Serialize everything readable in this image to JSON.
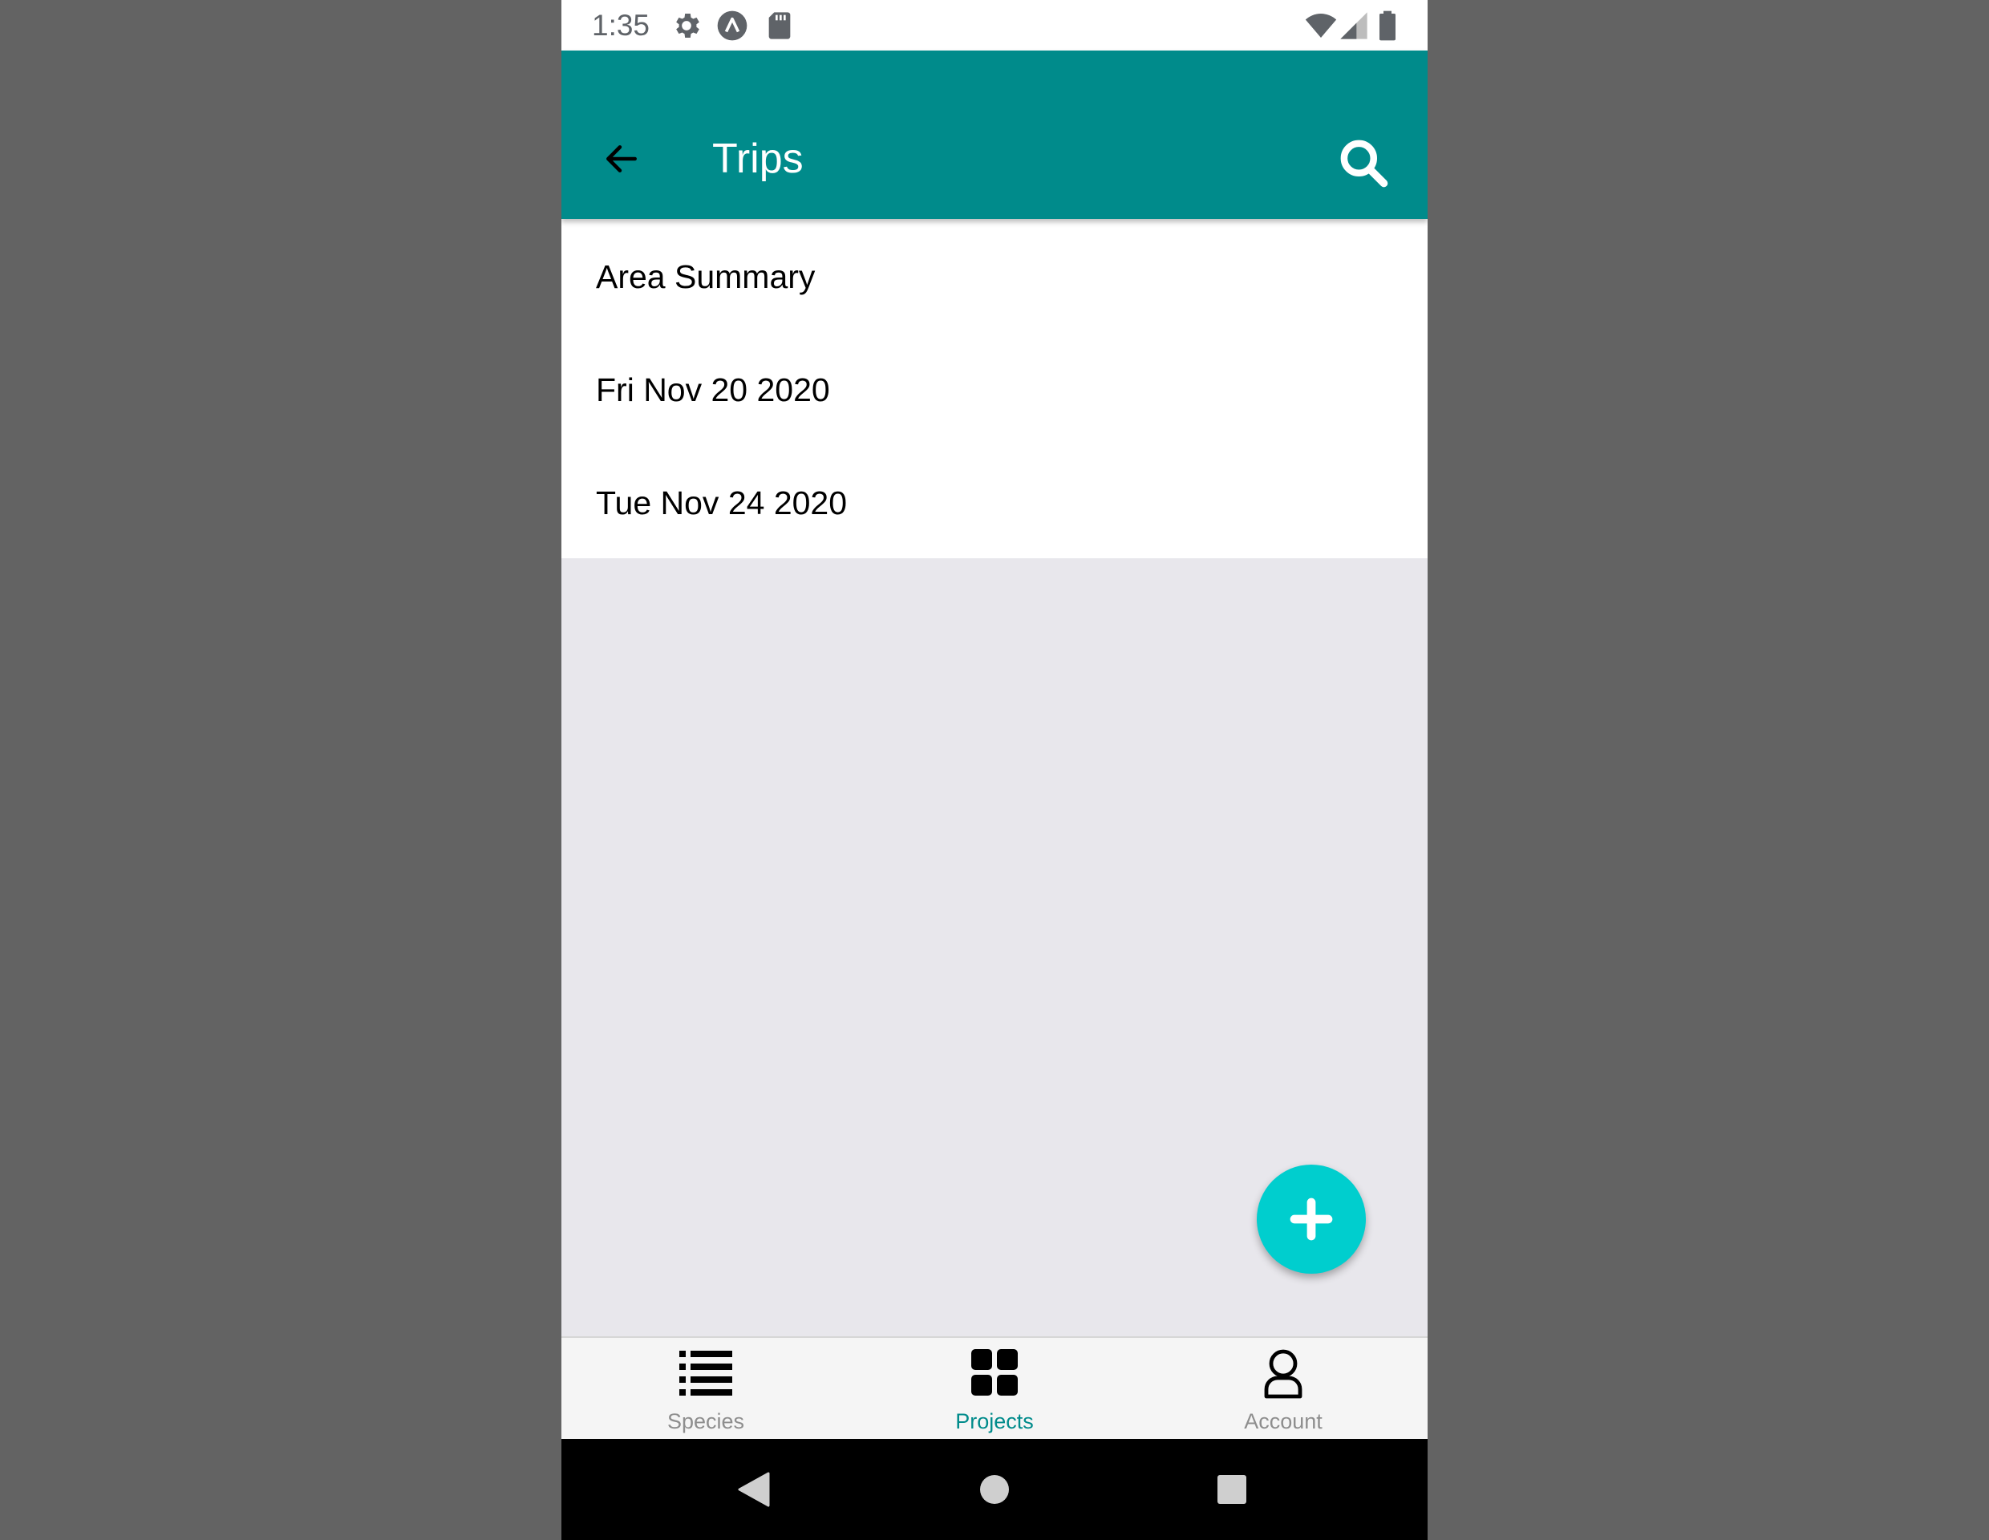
{
  "status_bar": {
    "time": "1:35",
    "icons": [
      "settings-icon",
      "app-notification-icon",
      "sd-card-icon",
      "wifi-icon",
      "signal-icon",
      "battery-icon"
    ]
  },
  "app_bar": {
    "title": "Trips",
    "back_icon": "arrow-left-icon",
    "search_icon": "search-icon",
    "background_color": "#008b8b"
  },
  "trips": [
    {
      "label": "Area Summary"
    },
    {
      "label": "Fri Nov 20 2020"
    },
    {
      "label": "Tue Nov 24 2020"
    }
  ],
  "fab": {
    "icon": "plus-icon",
    "color": "#00cece"
  },
  "tabs": [
    {
      "label": "Species",
      "icon": "list-icon",
      "active": false
    },
    {
      "label": "Projects",
      "icon": "grid-icon",
      "active": true
    },
    {
      "label": "Account",
      "icon": "user-icon",
      "active": false
    }
  ],
  "colors": {
    "accent": "#008b8b",
    "tab_inactive": "#8e8e8e",
    "content_background": "#e8e7ec"
  },
  "nav_bar": {
    "buttons": [
      "back-triangle-icon",
      "home-circle-icon",
      "recents-square-icon"
    ]
  }
}
